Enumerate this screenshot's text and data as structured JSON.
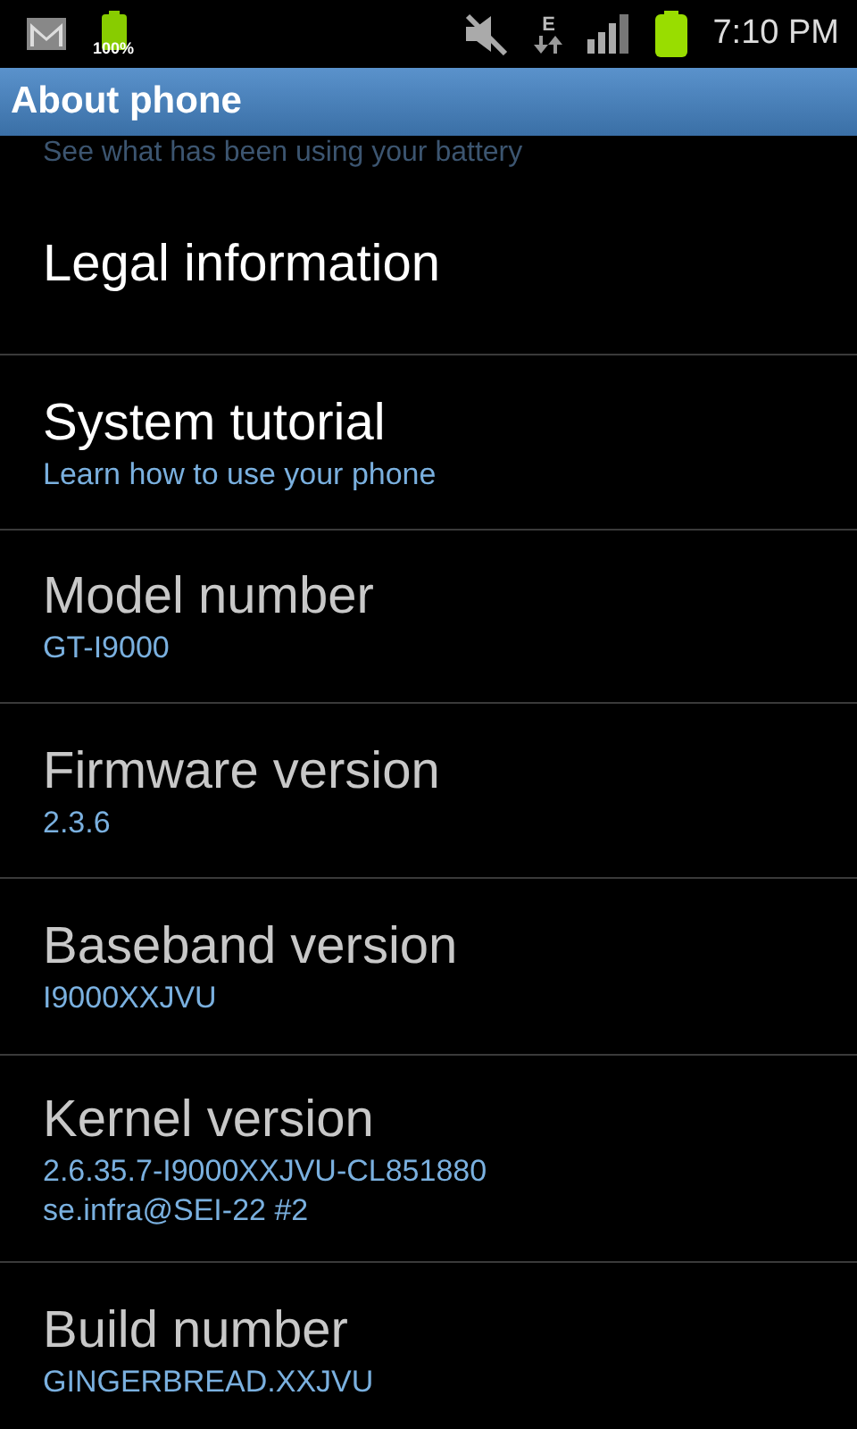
{
  "status_bar": {
    "battery_percent": "100%",
    "network_type": "E",
    "time": "7:10 PM"
  },
  "title_bar": {
    "title": "About phone"
  },
  "partial_summary": "See what has been using your battery",
  "items": [
    {
      "title": "Legal information",
      "enabled": true
    },
    {
      "title": "System tutorial",
      "summary": [
        "Learn how to use your phone"
      ],
      "enabled": true
    },
    {
      "title": "Model number",
      "summary": [
        "GT-I9000"
      ],
      "enabled": false
    },
    {
      "title": "Firmware version",
      "summary": [
        "2.3.6"
      ],
      "enabled": false
    },
    {
      "title": "Baseband version",
      "summary": [
        "I9000XXJVU"
      ],
      "enabled": false
    },
    {
      "title": "Kernel version",
      "summary": [
        "2.6.35.7-I9000XXJVU-CL851880",
        "se.infra@SEI-22 #2"
      ],
      "enabled": false
    },
    {
      "title": "Build number",
      "summary": [
        "GINGERBREAD.XXJVU"
      ],
      "enabled": false
    }
  ]
}
